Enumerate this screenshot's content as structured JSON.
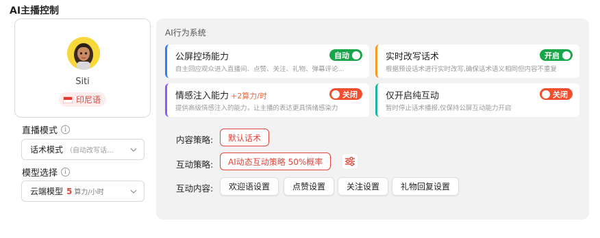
{
  "panel": {
    "title": "AI主播控制"
  },
  "profile": {
    "name": "Siti",
    "language": "印尼语"
  },
  "live_mode": {
    "label": "直播模式",
    "value": "话术模式",
    "hint": "（自动改写话…"
  },
  "model": {
    "label": "模型选择",
    "value": "云端模型",
    "cost": "5",
    "unit": "算力/小时"
  },
  "ai_system": {
    "title": "AI行为系统",
    "cards": [
      {
        "title": "公屏控场能力",
        "extra": "",
        "desc": "自主回应观众进入直播间、点赞、关注、礼物、弹幕评论...",
        "toggle": "自动",
        "state": "on",
        "accent": "#2f80ed"
      },
      {
        "title": "实时改写话术",
        "extra": "",
        "desc": "根据预设话术进行实时改写,确保话术语义相同但内容不重复",
        "toggle": "开启",
        "state": "on",
        "accent": "#f59a23"
      },
      {
        "title": "情感注入能力",
        "extra": "+2算力/时",
        "desc": "提供高级情感注入的能力，让主播的表达更具情绪感染力",
        "toggle": "关闭",
        "state": "off",
        "accent": "#8b5cf6"
      },
      {
        "title": "仅开启纯互动",
        "extra": "",
        "desc": "暂时停止话术播报,仅保持公屏互动能力开启",
        "toggle": "关闭",
        "state": "off",
        "accent": "#1fb5a5"
      }
    ]
  },
  "content_strategy": {
    "label": "内容策略:",
    "value": "默认话术"
  },
  "interaction_strategy": {
    "label": "互动策略:",
    "value": "AI动态互动策略 50%概率"
  },
  "interaction_content": {
    "label": "互动内容:",
    "items": [
      "欢迎语设置",
      "点赞设置",
      "关注设置",
      "礼物回复设置"
    ]
  },
  "colors": {
    "accent_red": "#e0443a",
    "toggle_on": "#19a54a",
    "toggle_off": "#f04e2c"
  }
}
